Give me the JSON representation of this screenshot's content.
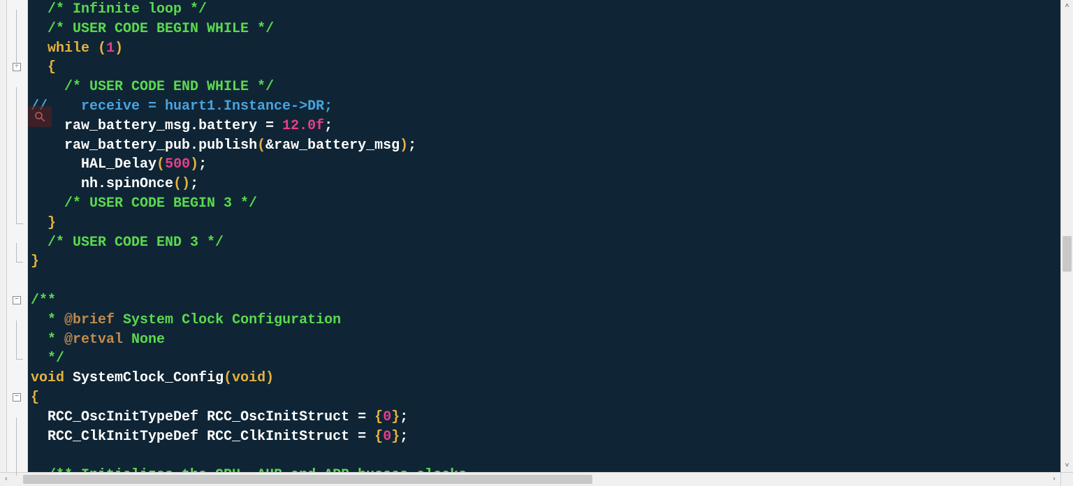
{
  "code": {
    "lines": [
      {
        "indent": "  ",
        "tokens": [
          {
            "c": "tok-comment",
            "t": "/* Infinite loop */"
          }
        ]
      },
      {
        "indent": "  ",
        "tokens": [
          {
            "c": "tok-comment",
            "t": "/* USER CODE BEGIN WHILE */"
          }
        ]
      },
      {
        "indent": "  ",
        "tokens": [
          {
            "c": "tok-keyword",
            "t": "while"
          },
          {
            "c": "tok-op",
            "t": " "
          },
          {
            "c": "tok-paren",
            "t": "("
          },
          {
            "c": "tok-num",
            "t": "1"
          },
          {
            "c": "tok-paren",
            "t": ")"
          }
        ]
      },
      {
        "indent": "  ",
        "tokens": [
          {
            "c": "tok-brace",
            "t": "{"
          }
        ]
      },
      {
        "indent": "    ",
        "tokens": [
          {
            "c": "tok-comment",
            "t": "/* USER CODE END WHILE */"
          }
        ]
      },
      {
        "indent": "",
        "tokens": [
          {
            "c": "tok-commented",
            "t": "//    receive = huart1.Instance->DR;"
          }
        ]
      },
      {
        "indent": "    ",
        "tokens": [
          {
            "c": "tok-ident",
            "t": "raw_battery_msg"
          },
          {
            "c": "tok-op",
            "t": "."
          },
          {
            "c": "tok-ident",
            "t": "battery"
          },
          {
            "c": "tok-op",
            "t": " "
          },
          {
            "c": "tok-op",
            "t": "="
          },
          {
            "c": "tok-op",
            "t": " "
          },
          {
            "c": "tok-num",
            "t": "12.0f"
          },
          {
            "c": "tok-semi",
            "t": ";"
          }
        ]
      },
      {
        "indent": "    ",
        "tokens": [
          {
            "c": "tok-ident",
            "t": "raw_battery_pub"
          },
          {
            "c": "tok-op",
            "t": "."
          },
          {
            "c": "tok-ident",
            "t": "publish"
          },
          {
            "c": "tok-paren",
            "t": "("
          },
          {
            "c": "tok-op",
            "t": "&"
          },
          {
            "c": "tok-ident",
            "t": "raw_battery_msg"
          },
          {
            "c": "tok-paren",
            "t": ")"
          },
          {
            "c": "tok-semi",
            "t": ";"
          }
        ]
      },
      {
        "indent": "      ",
        "tokens": [
          {
            "c": "tok-ident",
            "t": "HAL_Delay"
          },
          {
            "c": "tok-paren",
            "t": "("
          },
          {
            "c": "tok-num",
            "t": "500"
          },
          {
            "c": "tok-paren",
            "t": ")"
          },
          {
            "c": "tok-semi",
            "t": ";"
          }
        ]
      },
      {
        "indent": "      ",
        "tokens": [
          {
            "c": "tok-ident",
            "t": "nh"
          },
          {
            "c": "tok-op",
            "t": "."
          },
          {
            "c": "tok-ident",
            "t": "spinOnce"
          },
          {
            "c": "tok-paren",
            "t": "("
          },
          {
            "c": "tok-paren",
            "t": ")"
          },
          {
            "c": "tok-semi",
            "t": ";"
          }
        ]
      },
      {
        "indent": "    ",
        "tokens": [
          {
            "c": "tok-comment",
            "t": "/* USER CODE BEGIN 3 */"
          }
        ]
      },
      {
        "indent": "  ",
        "tokens": [
          {
            "c": "tok-brace",
            "t": "}"
          }
        ]
      },
      {
        "indent": "  ",
        "tokens": [
          {
            "c": "tok-comment",
            "t": "/* USER CODE END 3 */"
          }
        ]
      },
      {
        "indent": "",
        "tokens": [
          {
            "c": "tok-brace",
            "t": "}"
          }
        ]
      },
      {
        "indent": "",
        "tokens": []
      },
      {
        "indent": "",
        "tokens": [
          {
            "c": "tok-comment",
            "t": "/*"
          },
          {
            "c": "tok-comment",
            "t": "*"
          }
        ]
      },
      {
        "indent": "  ",
        "tokens": [
          {
            "c": "tok-comment",
            "t": "* "
          },
          {
            "c": "tok-doxytag",
            "t": "@brief"
          },
          {
            "c": "tok-comment",
            "t": " System Clock Configuration"
          }
        ]
      },
      {
        "indent": "  ",
        "tokens": [
          {
            "c": "tok-comment",
            "t": "* "
          },
          {
            "c": "tok-doxytag",
            "t": "@retval"
          },
          {
            "c": "tok-comment",
            "t": " None"
          }
        ]
      },
      {
        "indent": "  ",
        "tokens": [
          {
            "c": "tok-comment",
            "t": "*/"
          }
        ]
      },
      {
        "indent": "",
        "tokens": [
          {
            "c": "tok-keyword",
            "t": "void"
          },
          {
            "c": "tok-op",
            "t": " "
          },
          {
            "c": "tok-ident",
            "t": "SystemClock_Config"
          },
          {
            "c": "tok-paren",
            "t": "("
          },
          {
            "c": "tok-keyword",
            "t": "void"
          },
          {
            "c": "tok-paren",
            "t": ")"
          }
        ]
      },
      {
        "indent": "",
        "tokens": [
          {
            "c": "tok-brace",
            "t": "{"
          }
        ]
      },
      {
        "indent": "  ",
        "tokens": [
          {
            "c": "tok-ident",
            "t": "RCC_OscInitTypeDef"
          },
          {
            "c": "tok-op",
            "t": " "
          },
          {
            "c": "tok-ident",
            "t": "RCC_OscInitStruct"
          },
          {
            "c": "tok-op",
            "t": " "
          },
          {
            "c": "tok-op",
            "t": "="
          },
          {
            "c": "tok-op",
            "t": " "
          },
          {
            "c": "tok-brace",
            "t": "{"
          },
          {
            "c": "tok-num",
            "t": "0"
          },
          {
            "c": "tok-brace",
            "t": "}"
          },
          {
            "c": "tok-semi",
            "t": ";"
          }
        ]
      },
      {
        "indent": "  ",
        "tokens": [
          {
            "c": "tok-ident",
            "t": "RCC_ClkInitTypeDef"
          },
          {
            "c": "tok-op",
            "t": " "
          },
          {
            "c": "tok-ident",
            "t": "RCC_ClkInitStruct"
          },
          {
            "c": "tok-op",
            "t": " "
          },
          {
            "c": "tok-op",
            "t": "="
          },
          {
            "c": "tok-op",
            "t": " "
          },
          {
            "c": "tok-brace",
            "t": "{"
          },
          {
            "c": "tok-num",
            "t": "0"
          },
          {
            "c": "tok-brace",
            "t": "}"
          },
          {
            "c": "tok-semi",
            "t": ";"
          }
        ]
      },
      {
        "indent": "",
        "tokens": []
      },
      {
        "indent": "  ",
        "tokens": [
          {
            "c": "tok-comment",
            "t": "/** Initializes the CPU, AHB and APB busses clocks"
          }
        ]
      }
    ]
  },
  "fold_marks": [
    {
      "line": 3,
      "glyph": "−"
    },
    {
      "line": 15,
      "glyph": "−"
    },
    {
      "line": 20,
      "glyph": "−"
    }
  ],
  "fold_vlines": [
    {
      "from": 0,
      "to": 3
    },
    {
      "from": 4,
      "to": 11
    },
    {
      "from": 12,
      "to": 13
    },
    {
      "from": 16,
      "to": 18
    },
    {
      "from": 21,
      "to": 24
    }
  ],
  "fold_endcaps": [
    11,
    13,
    18
  ],
  "scroll": {
    "vthumb_top_pct": 50,
    "vthumb_height_pct": 8,
    "hthumb_left_pct": 1,
    "hthumb_width_pct": 55
  },
  "glyphs": {
    "up": "˄",
    "down": "˅",
    "left": "‹",
    "right": "›"
  }
}
